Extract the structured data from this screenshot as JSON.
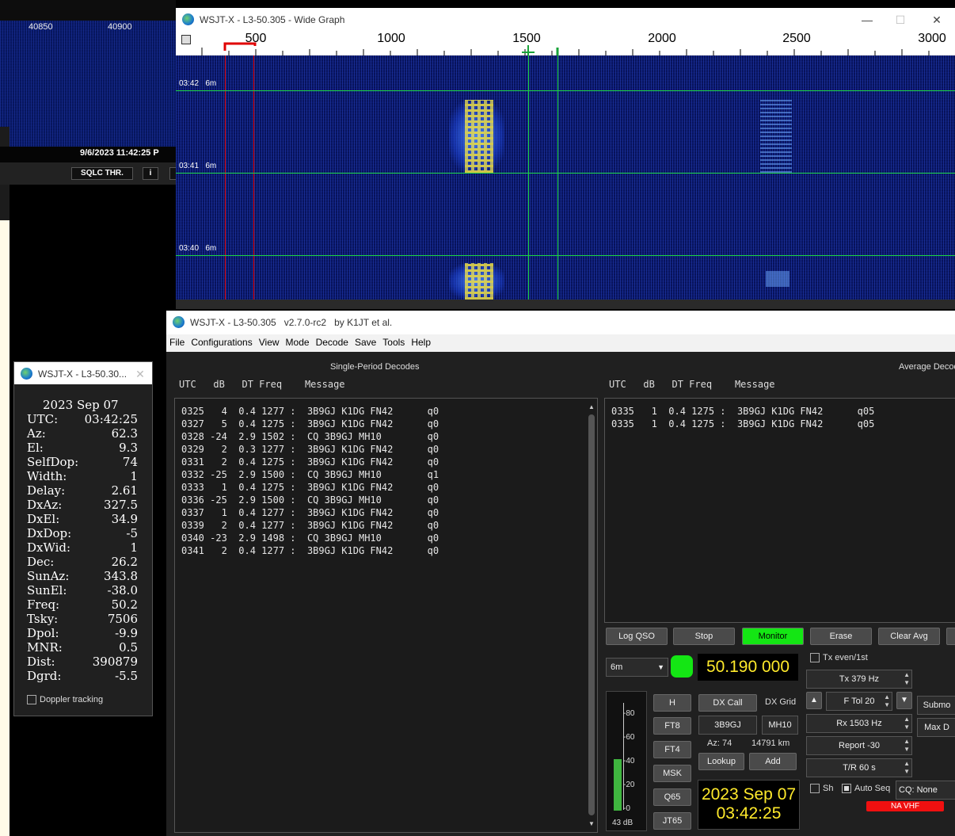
{
  "background_app": {
    "freq_ticks": [
      "40850",
      "40900"
    ],
    "datetime": "9/6/2023 11:42:25 P",
    "sqlc_button": "SQLC THR.",
    "info_button": "i"
  },
  "wide_graph": {
    "title": "WSJT-X - L3-50.305 - Wide Graph",
    "scale": [
      "500",
      "1000",
      "1500",
      "2000",
      "2500",
      "3000"
    ],
    "rows": [
      {
        "time": "03:42",
        "band": "6m"
      },
      {
        "time": "03:41",
        "band": "6m"
      },
      {
        "time": "03:40",
        "band": "6m"
      }
    ]
  },
  "main": {
    "title": "WSJT-X - L3-50.305",
    "version": "v2.7.0-rc2",
    "by": "by K1JT et al.",
    "menu": [
      "File",
      "Configurations",
      "View",
      "Mode",
      "Decode",
      "Save",
      "Tools",
      "Help"
    ],
    "single_title": "Single-Period Decodes",
    "average_title": "Average Decodes",
    "col_header": "UTC   dB   DT Freq    Message",
    "single_decodes": [
      "0325   4  0.4 1277 :  3B9GJ K1DG FN42      q0",
      "0327   5  0.4 1275 :  3B9GJ K1DG FN42      q0",
      "0328 -24  2.9 1502 :  CQ 3B9GJ MH10        q0",
      "0329   2  0.3 1277 :  3B9GJ K1DG FN42      q0",
      "0331   2  0.4 1275 :  3B9GJ K1DG FN42      q0",
      "0332 -25  2.9 1500 :  CQ 3B9GJ MH10        q1",
      "0333   1  0.4 1275 :  3B9GJ K1DG FN42      q0",
      "0336 -25  2.9 1500 :  CQ 3B9GJ MH10        q0",
      "0337   1  0.4 1277 :  3B9GJ K1DG FN42      q0",
      "0339   2  0.4 1277 :  3B9GJ K1DG FN42      q0",
      "0340 -23  2.9 1498 :  CQ 3B9GJ MH10        q0",
      "0341   2  0.4 1277 :  3B9GJ K1DG FN42      q0"
    ],
    "average_decodes": [
      "0335   1  0.4 1275 :  3B9GJ K1DG FN42      q05",
      "0335   1  0.4 1275 :  3B9GJ K1DG FN42      q05"
    ],
    "buttons": {
      "log_qso": "Log QSO",
      "stop": "Stop",
      "monitor": "Monitor",
      "erase": "Erase",
      "clear_avg": "Clear Avg"
    },
    "band": "6m",
    "frequency": "50.190 000",
    "tx_even": "Tx even/1st",
    "tx": "Tx  379  Hz",
    "ftol": "F Tol  20",
    "rx": "Rx  1503  Hz",
    "report": "Report  -30",
    "tr": "T/R  60  s",
    "submode": "Submo",
    "maxd": "Max D",
    "mode_buttons": [
      "H",
      "FT8",
      "FT4",
      "MSK",
      "Q65",
      "JT65"
    ],
    "dx_call_button": "DX Call",
    "dx_grid_label": "DX Grid",
    "dx_call": "3B9GJ",
    "dx_grid": "MH10",
    "az": "Az: 74",
    "dist": "14791 km",
    "lookup": "Lookup",
    "add": "Add",
    "date": "2023 Sep 07",
    "time": "03:42:25",
    "sh": "Sh",
    "auto_seq": "Auto Seq",
    "cq": "CQ: None",
    "na_vhf": "NA VHF",
    "meter_ticks": [
      "80",
      "60",
      "40",
      "20",
      "0"
    ],
    "meter_db": "43 dB",
    "meter_level": 0.43
  },
  "astro": {
    "title": "WSJT-X - L3-50.30...",
    "date": "2023 Sep 07",
    "rows": [
      {
        "k": "UTC:",
        "v": "03:42:25"
      },
      {
        "k": "Az:",
        "v": "62.3"
      },
      {
        "k": "El:",
        "v": "9.3"
      },
      {
        "k": "SelfDop:",
        "v": "74"
      },
      {
        "k": "Width:",
        "v": "1"
      },
      {
        "k": "Delay:",
        "v": "2.61"
      },
      {
        "k": "DxAz:",
        "v": "327.5"
      },
      {
        "k": "DxEl:",
        "v": "34.9"
      },
      {
        "k": "DxDop:",
        "v": "-5"
      },
      {
        "k": "DxWid:",
        "v": "1"
      },
      {
        "k": "Dec:",
        "v": "26.2"
      },
      {
        "k": "SunAz:",
        "v": "343.8"
      },
      {
        "k": "SunEl:",
        "v": "-38.0"
      },
      {
        "k": "Freq:",
        "v": "50.2"
      },
      {
        "k": "Tsky:",
        "v": "7506"
      },
      {
        "k": "Dpol:",
        "v": "-9.9"
      },
      {
        "k": "MNR:",
        "v": "0.5"
      },
      {
        "k": "Dist:",
        "v": "390879"
      },
      {
        "k": "Dgrd:",
        "v": "-5.5"
      }
    ],
    "doppler": "Doppler tracking"
  }
}
